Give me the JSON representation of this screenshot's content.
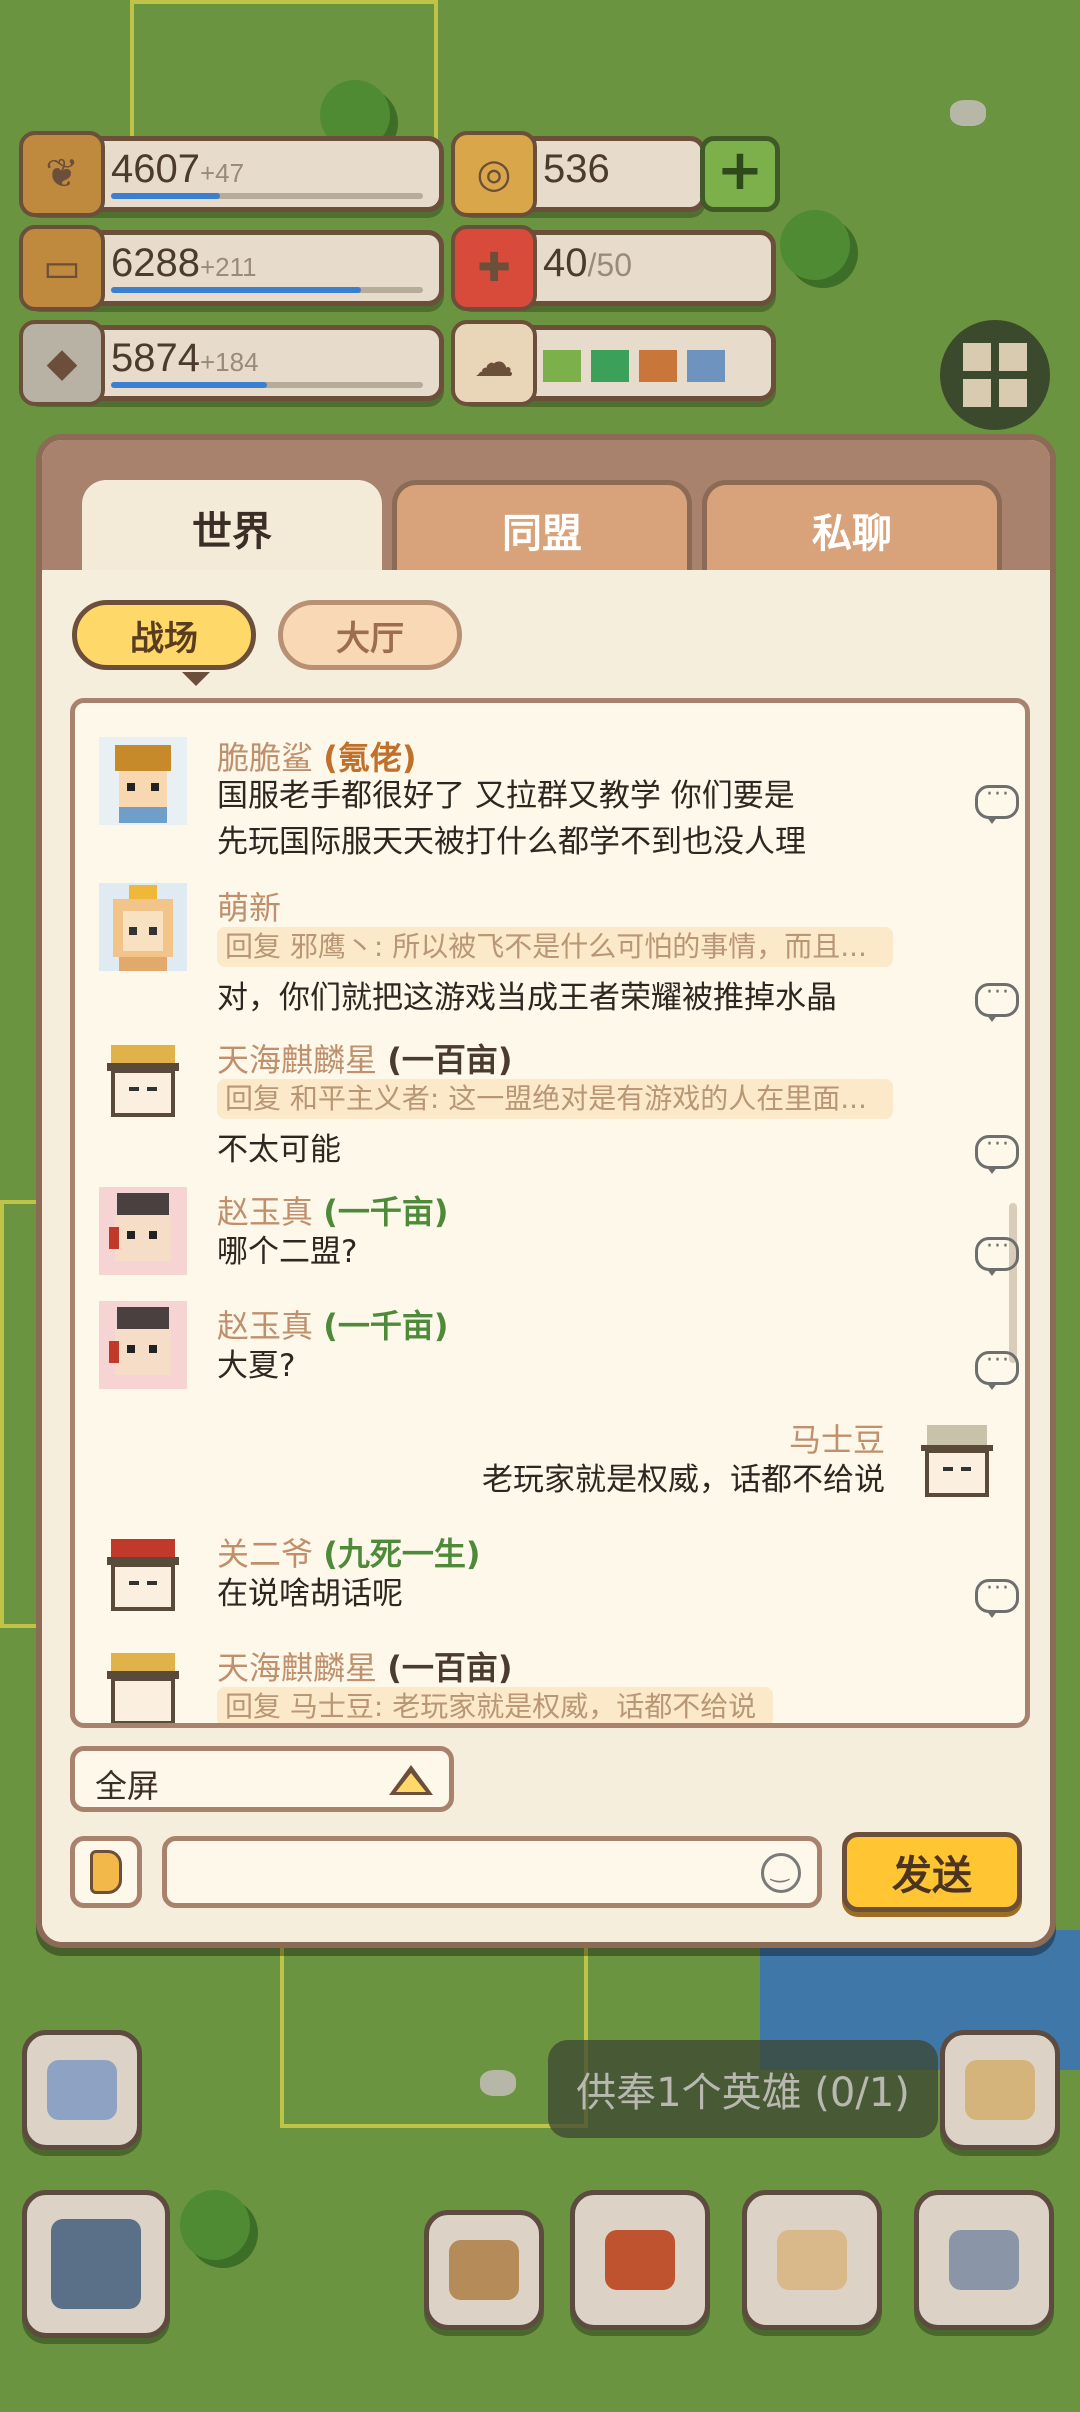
{
  "resources": [
    {
      "value": "4607",
      "increment": "+47",
      "icon": "wheat-icon",
      "fill": 0.35
    },
    {
      "value": "6288",
      "increment": "+211",
      "icon": "wood-icon",
      "fill": 0.8
    },
    {
      "value": "5874",
      "increment": "+184",
      "icon": "stone-icon",
      "fill": 0.5
    }
  ],
  "currency": {
    "value": "536",
    "icon": "coin-icon"
  },
  "gifts": {
    "value": "40",
    "max": "/50",
    "icon": "gift-icon"
  },
  "weather": {
    "icon": "weather-icon",
    "swatches": [
      "#7cb04a",
      "#3aa05a",
      "#c9763a",
      "#6f93bf"
    ]
  },
  "chat": {
    "tabs": [
      "世界",
      "同盟",
      "私聊"
    ],
    "sub_tabs": [
      "战场",
      "大厅"
    ],
    "messages": [
      {
        "name": "脆脆鲨",
        "title": "(氪佬)",
        "lines": [
          "国服老手都很好了 又拉群又教学       你们要是",
          "先玩国际服天天被打什么都学不到也没人理"
        ]
      },
      {
        "name": "萌新",
        "reply": "回复 邪鹰丶: 所以被飞不是什么可怕的事情，而且...",
        "lines": [
          "对，你们就把这游戏当成王者荣耀被推掉水晶"
        ]
      },
      {
        "name": "天海麒麟星",
        "title": "(一百亩)",
        "reply": "回复 和平主义者: 这一盟绝对是有游戏的人在里面...",
        "lines": [
          "不太可能"
        ]
      },
      {
        "name": "赵玉真",
        "title": "(一千亩)",
        "lines": [
          "哪个二盟?"
        ]
      },
      {
        "name": "赵玉真",
        "title": "(一千亩)",
        "lines": [
          "大夏?"
        ]
      },
      {
        "name": "马士豆",
        "lines": [
          "老玩家就是权威，话都不给说"
        ],
        "self": true
      },
      {
        "name": "关二爷",
        "title": "(九死一生)",
        "lines": [
          "在说啥胡话呢"
        ]
      },
      {
        "name": "天海麒麟星",
        "title": "(一百亩)",
        "reply": "回复 马士豆: 老玩家就是权威，话都不给说"
      }
    ],
    "fullscreen_label": "全屏",
    "input_placeholder": "",
    "send_label": "发送"
  },
  "toast": "供奉1个英雄 (0/1)",
  "colors": {
    "accent": "#ffc533",
    "panel": "#f3ead7",
    "border": "#8b6a56"
  }
}
